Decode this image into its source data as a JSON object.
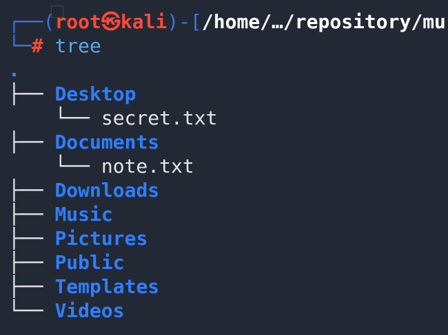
{
  "prompt": {
    "frame_open": "┌──(",
    "user": "root",
    "at_symbol": "㉿",
    "host": "kali",
    "frame_mid": ")-[",
    "path": "/home/…/repository/mu",
    "frame_close": "└─",
    "hash": "#",
    "command": "tree"
  },
  "tree": {
    "root": ".",
    "entries": [
      {
        "connector": "├── ",
        "name": "Desktop",
        "type": "dir"
      },
      {
        "connector": "    └── ",
        "name": "secret.txt",
        "type": "file"
      },
      {
        "connector": "├── ",
        "name": "Documents",
        "type": "dir"
      },
      {
        "connector": "    └── ",
        "name": "note.txt",
        "type": "file"
      },
      {
        "connector": "├── ",
        "name": "Downloads",
        "type": "dir"
      },
      {
        "connector": "├── ",
        "name": "Music",
        "type": "dir"
      },
      {
        "connector": "├── ",
        "name": "Pictures",
        "type": "dir"
      },
      {
        "connector": "├── ",
        "name": "Public",
        "type": "dir"
      },
      {
        "connector": "├── ",
        "name": "Templates",
        "type": "dir"
      },
      {
        "connector": "└── ",
        "name": "Videos",
        "type": "dir"
      }
    ]
  },
  "colors": {
    "background": "#232835",
    "frame": "#3a74e0",
    "user_host": "#ff4a3a",
    "directory": "#2f7fff",
    "command": "#58a9e8",
    "text": "#e6e6e6"
  }
}
